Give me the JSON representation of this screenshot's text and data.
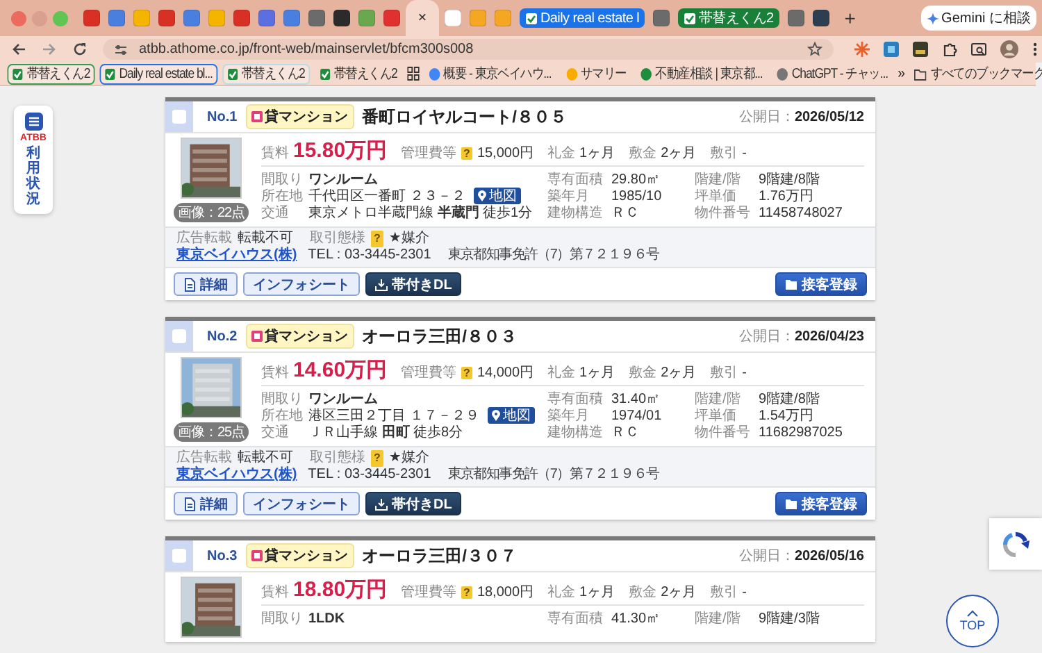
{
  "browser": {
    "tabs": [
      {
        "kind": "favicon",
        "color": "#d93025",
        "selected": false
      },
      {
        "kind": "favicon",
        "color": "#4a7fe0",
        "selected": false
      },
      {
        "kind": "favicon",
        "color": "#f4b400",
        "selected": false
      },
      {
        "kind": "favicon",
        "color": "#d93025",
        "selected": false
      },
      {
        "kind": "favicon",
        "color": "#4a7fe0",
        "selected": false
      },
      {
        "kind": "favicon",
        "color": "#f4b400",
        "selected": false
      },
      {
        "kind": "favicon",
        "color": "#d93025",
        "selected": false
      },
      {
        "kind": "favicon",
        "color": "#5b6fe0",
        "selected": false
      },
      {
        "kind": "favicon",
        "color": "#4a7fe0",
        "selected": false
      },
      {
        "kind": "favicon",
        "color": "#6b6b6b",
        "selected": false
      },
      {
        "kind": "favicon",
        "color": "#2b2b2b",
        "selected": false
      },
      {
        "kind": "favicon",
        "color": "#6aa84f",
        "selected": false
      },
      {
        "kind": "favicon",
        "color": "#e03030",
        "selected": false
      },
      {
        "kind": "favicon",
        "close": "×",
        "selected": true
      },
      {
        "kind": "favicon",
        "color": "#ffffff",
        "selected": false
      },
      {
        "kind": "favicon",
        "color": "#f5a623",
        "selected": false
      },
      {
        "kind": "favicon",
        "color": "#f5a623",
        "selected": false
      },
      {
        "kind": "group",
        "label": "Daily real estate l",
        "color": "#1a73e8",
        "selected": false
      },
      {
        "kind": "favicon",
        "color": "#6b6b6b",
        "selected": false
      },
      {
        "kind": "group",
        "label": "帯替えくん2",
        "color": "#188038",
        "selected": false
      },
      {
        "kind": "favicon",
        "color": "#6b6b6b",
        "selected": false
      },
      {
        "kind": "favicon",
        "color": "#2c3e50",
        "selected": false
      }
    ],
    "new_tab": "+",
    "gemini_button": "Gemini に相談",
    "address": "atbb.athome.co.jp/front-web/mainservlet/bfcm300s008",
    "bookmarks": [
      {
        "kind": "tool",
        "label": "帯替えくん2",
        "color": "#2e9e4f"
      },
      {
        "kind": "tool",
        "label": "Daily real estate bl...",
        "color": "#1a73e8"
      },
      {
        "kind": "tool",
        "label": "帯替えくん2",
        "color": "#b9dbe8"
      },
      {
        "kind": "tool",
        "label": "帯替えくん2"
      },
      {
        "kind": "apps"
      },
      {
        "kind": "site",
        "label": "概要 - 東京ベイハウ...",
        "color": "#4285f4"
      },
      {
        "kind": "site",
        "label": "サマリー",
        "color": "#f9ab00"
      },
      {
        "kind": "site",
        "label": "不動産相談 | 東京都...",
        "color": "#1e8e3e"
      },
      {
        "kind": "site",
        "label": "ChatGPT - チャッ...",
        "color": "#777777"
      }
    ],
    "more_bookmarks": "»",
    "all_bookmarks": "すべてのブックマーク"
  },
  "sidebar": {
    "logo": "ATBB",
    "label": "利用状況"
  },
  "listings": [
    {
      "no": "No.1",
      "type": "貸マンション",
      "title": "番町ロイヤルコート/８０５",
      "date": "公開日：**2026/05/12**",
      "checked": false,
      "photo_count": "画像：22点",
      "rent_label": "賃料",
      "rent": "15.80万円",
      "fees": [
        {
          "label": "管理費等",
          "help": "?",
          "value": "15,000円"
        },
        {
          "label": "礼金",
          "value": "1ヶ月"
        },
        {
          "label": "敷金",
          "value": "2ヶ月"
        },
        {
          "label": "敷引",
          "value": "-"
        }
      ],
      "details": [
        {
          "label": "間取り",
          "value": "ワンルーム"
        },
        {
          "label": "専有面積",
          "value": "29.80㎡"
        },
        {
          "label": "階建/階",
          "value": "9階建/8階"
        },
        {
          "label": "所在地",
          "value": "千代田区一番町 ２３－２",
          "map_button": "地図"
        },
        {
          "label": "築年月",
          "value": "1985/10"
        },
        {
          "label": "坪単価",
          "value": "1.76万円"
        },
        {
          "label": "交通",
          "value": "東京メトロ半蔵門線 **半蔵門** 徒歩1分"
        },
        {
          "label": "建物構造",
          "value": "ＲＣ"
        },
        {
          "label": "物件番号",
          "value": "11458748027"
        }
      ],
      "footer": {
        "ad_label": "広告転載",
        "ad_value": "転載不可",
        "deal_label": "取引態様",
        "deal_help": "?",
        "deal_value": "★媒介",
        "company": "東京ベイハウス(株)",
        "tel": "TEL : 03-3445-2301",
        "license": "東京都知事免許（7）第７２１９６号"
      },
      "buttons": [
        "詳細",
        "インフォシート",
        "帯付きDL",
        "接客登録"
      ]
    },
    {
      "no": "No.2",
      "type": "貸マンション",
      "title": "オーロラ三田/８０３",
      "date": "公開日：**2026/04/23**",
      "checked": false,
      "photo_count": "画像：25点",
      "rent_label": "賃料",
      "rent": "14.60万円",
      "fees": [
        {
          "label": "管理費等",
          "help": "?",
          "value": "14,000円"
        },
        {
          "label": "礼金",
          "value": "1ヶ月"
        },
        {
          "label": "敷金",
          "value": "2ヶ月"
        },
        {
          "label": "敷引",
          "value": "-"
        }
      ],
      "details": [
        {
          "label": "間取り",
          "value": "ワンルーム"
        },
        {
          "label": "専有面積",
          "value": "31.40㎡"
        },
        {
          "label": "階建/階",
          "value": "9階建/8階"
        },
        {
          "label": "所在地",
          "value": "港区三田２丁目 １７－２９",
          "map_button": "地図"
        },
        {
          "label": "築年月",
          "value": "1974/01"
        },
        {
          "label": "坪単価",
          "value": "1.54万円"
        },
        {
          "label": "交通",
          "value": "ＪＲ山手線 **田町** 徒歩8分"
        },
        {
          "label": "建物構造",
          "value": "ＲＣ"
        },
        {
          "label": "物件番号",
          "value": "11682987025"
        }
      ],
      "footer": {
        "ad_label": "広告転載",
        "ad_value": "転載不可",
        "deal_label": "取引態様",
        "deal_help": "?",
        "deal_value": "★媒介",
        "company": "東京ベイハウス(株)",
        "tel": "TEL : 03-3445-2301",
        "license": "東京都知事免許（7）第７２１９６号"
      },
      "buttons": [
        "詳細",
        "インフォシート",
        "帯付きDL",
        "接客登録"
      ]
    },
    {
      "no": "No.3",
      "type": "貸マンション",
      "title": "オーロラ三田/３０７",
      "date": "公開日：**2026/05/16**",
      "checked": false,
      "rent_label": "賃料",
      "rent": "18.80万円",
      "fees": [
        {
          "label": "管理費等",
          "help": "?",
          "value": "18,000円"
        },
        {
          "label": "礼金",
          "value": "1ヶ月"
        },
        {
          "label": "敷金",
          "value": "2ヶ月"
        },
        {
          "label": "敷引",
          "value": "-"
        }
      ],
      "details": [
        {
          "label": "間取り",
          "value": "1LDK"
        },
        {
          "label": "専有面積",
          "value": "41.30㎡"
        },
        {
          "label": "階建/階",
          "value": "9階建/3階"
        }
      ]
    }
  ],
  "top_button": "TOP"
}
